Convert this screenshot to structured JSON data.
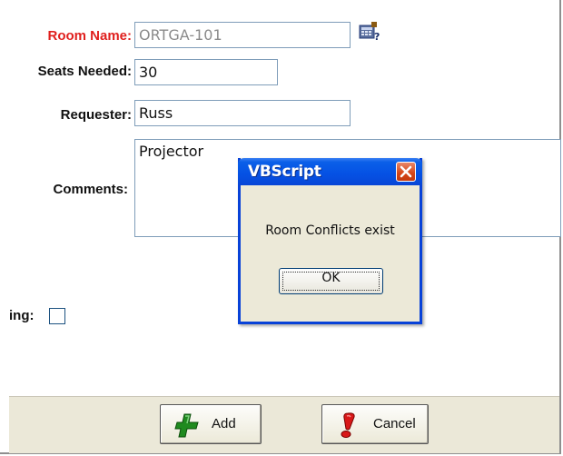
{
  "form": {
    "room_name": {
      "label": "Room Name:",
      "value": "ORTGA-101"
    },
    "seats_needed": {
      "label": "Seats Needed:",
      "value": "30"
    },
    "requester": {
      "label": "Requester:",
      "value": "Russ"
    },
    "comments": {
      "label": "Comments:",
      "value": "Projector"
    },
    "checkbox_label": "ing:",
    "checkbox_checked": false,
    "label_accent_color": "#e0201e"
  },
  "buttons": {
    "add": {
      "label": "Add",
      "icon": "green-plus-icon"
    },
    "cancel": {
      "label": "Cancel",
      "icon": "red-exclamation-icon"
    }
  },
  "dialog": {
    "title": "VBScript",
    "message": "Room Conflicts exist",
    "ok_label": "OK",
    "close_icon": "close-icon",
    "titlebar_color": "#0551e4"
  }
}
